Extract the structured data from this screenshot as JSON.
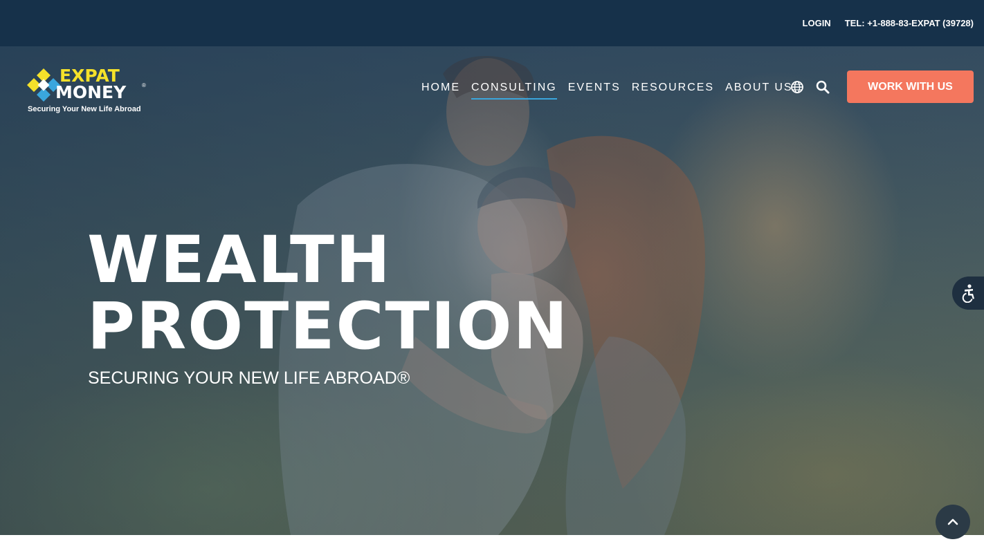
{
  "topbar": {
    "login_label": "LOGIN",
    "phone_label": "TEL: +1-888-83-EXPAT (39728)"
  },
  "logo": {
    "line1": "EXPAT",
    "line2": "MONEY",
    "registered": "®",
    "tagline": "Securing Your New Life Abroad"
  },
  "nav": {
    "items": [
      {
        "label": "HOME"
      },
      {
        "label": "CONSULTING"
      },
      {
        "label": "EVENTS"
      },
      {
        "label": "RESOURCES"
      },
      {
        "label": "ABOUT US"
      }
    ],
    "active": "CONSULTING"
  },
  "icons": {
    "language": "globe-icon",
    "search": "search-icon",
    "accessibility": "accessibility-icon",
    "scroll_top": "chevron-up-icon"
  },
  "cta": {
    "label": "WORK WITH US"
  },
  "hero": {
    "title_line1": "WEALTH",
    "title_line2": "PROTECTION",
    "subtitle": "SECURING YOUR NEW LIFE ABROAD®"
  },
  "colors": {
    "topbar": "#16314a",
    "cta": "#f4775e",
    "logo_yellow": "#f5e12a",
    "active_underline": "#3aa6dd"
  }
}
